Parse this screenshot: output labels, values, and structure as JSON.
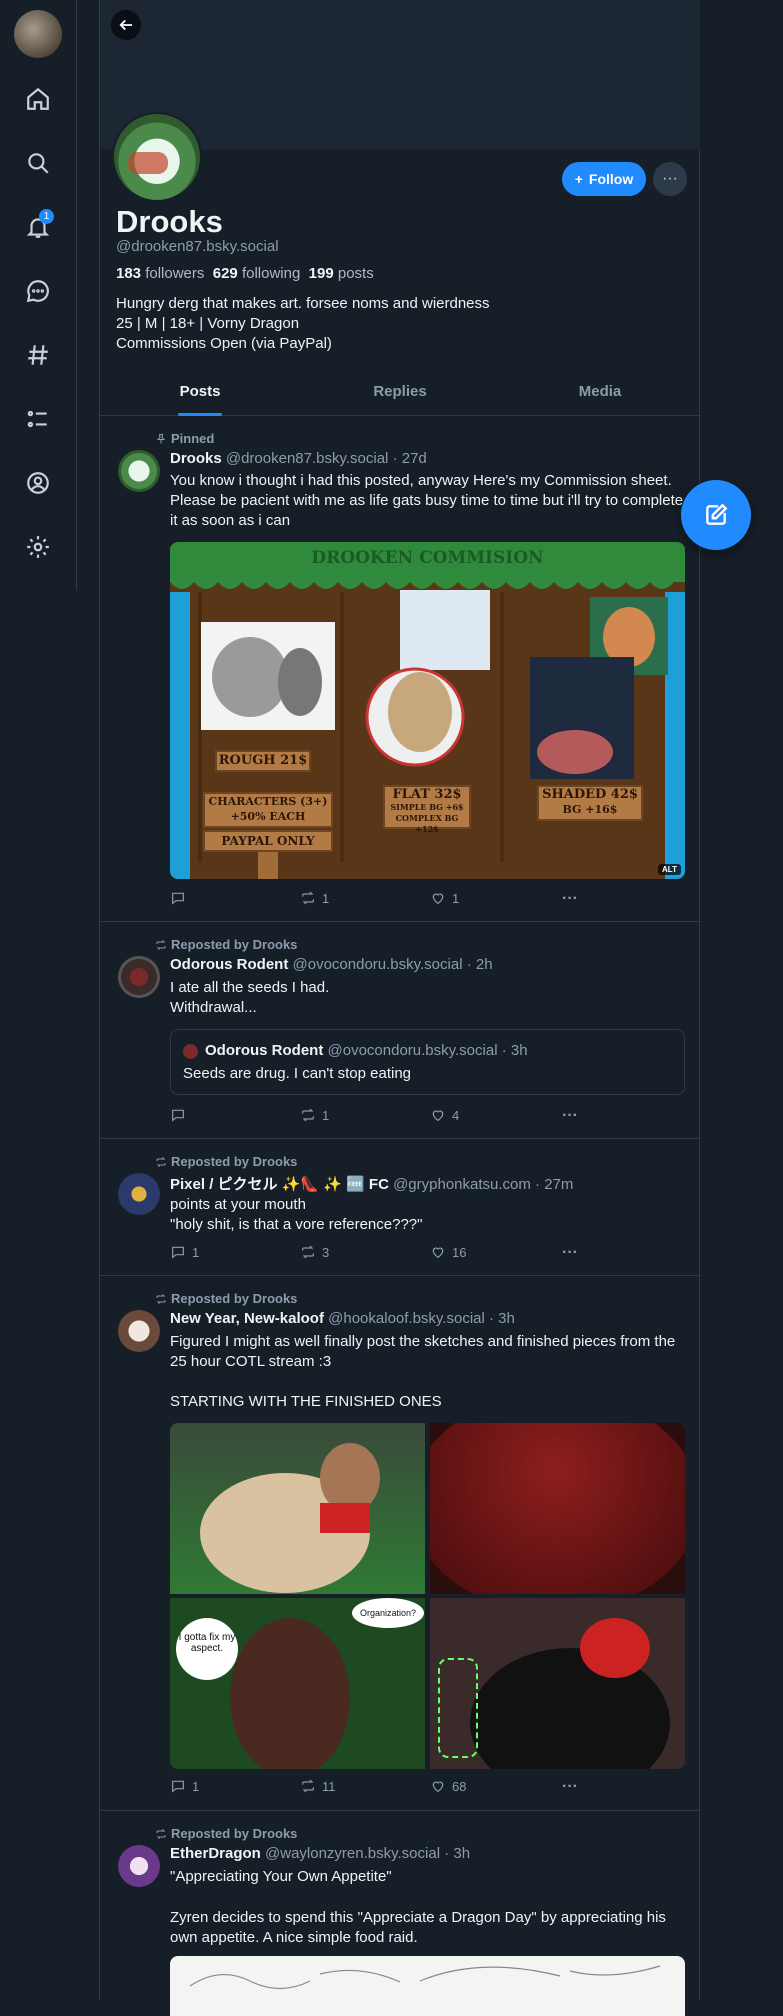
{
  "sidebar": {
    "items": [
      {
        "name": "home",
        "icon": "home-icon"
      },
      {
        "name": "search",
        "icon": "search-icon"
      },
      {
        "name": "notifications",
        "icon": "bell-icon",
        "badge": "1"
      },
      {
        "name": "chat",
        "icon": "chat-icon"
      },
      {
        "name": "feeds",
        "icon": "hash-icon"
      },
      {
        "name": "lists",
        "icon": "list-icon"
      },
      {
        "name": "profile",
        "icon": "user-circle-icon"
      },
      {
        "name": "settings",
        "icon": "gear-icon"
      }
    ]
  },
  "profile": {
    "name": "Drooks",
    "handle": "@drooken87.bsky.social",
    "followers_count": "183",
    "followers_label": "followers",
    "following_count": "629",
    "following_label": "following",
    "posts_count": "199",
    "posts_label": "posts",
    "bio_line1": "Hungry derg that makes art. forsee noms and wierdness",
    "bio_line2": "25 | M | 18+ | Vorny Dragon",
    "bio_line3": "Commissions Open (via PayPal)",
    "follow_label": "Follow"
  },
  "tabs": [
    "Posts",
    "Replies",
    "Media"
  ],
  "posts": [
    {
      "context": "Pinned",
      "author": "Drooks",
      "handle": "@drooken87.bsky.social",
      "time": "· 27d",
      "text": "You know i thought i had this posted, anyway Here's my Commission sheet. Please be pacient with me as life gats busy time to time but i'll try to complete it as soon as i can",
      "image_text": {
        "title": "DROOKEN COMMISION",
        "rough": "ROUGH 21$",
        "characters_l1": "CHARACTERS (3+)",
        "characters_l2": "+50% EACH",
        "paypal": "PAYPAL ONLY",
        "flat": "FLAT 32$",
        "flat_l1": "SIMPLE BG +6$",
        "flat_l2": "COMPLEX BG +12$",
        "shaded": "SHADED 42$",
        "shaded_l1": "BG +16$",
        "alt": "ALT"
      },
      "replies": "",
      "reposts": "1",
      "likes": "1"
    },
    {
      "context": "Reposted by Drooks",
      "author": "Odorous Rodent",
      "handle": "@ovocondoru.bsky.social",
      "time": "· 2h",
      "text_l1": "I ate all the seeds I had.",
      "text_l2": "Withdrawal...",
      "quote_author": "Odorous Rodent",
      "quote_handle": "@ovocondoru.bsky.social",
      "quote_time": "· 3h",
      "quote_text": "Seeds are drug. I can't stop eating",
      "replies": "",
      "reposts": "1",
      "likes": "4"
    },
    {
      "context": "Reposted by Drooks",
      "author": "Pixel / ピクセル ✨👠 ✨ 🆓 FC",
      "handle": "@gryphonkatsu.com",
      "time": "· 27m",
      "text_l1": "points at your mouth",
      "text_l2": "\"holy shit, is that a vore reference???\"",
      "replies": "1",
      "reposts": "3",
      "likes": "16"
    },
    {
      "context": "Reposted by Drooks",
      "author": "New Year, New-kaloof",
      "handle": "@hookaloof.bsky.social",
      "time": "· 3h",
      "text": "Figured I might as well finally post the sketches and finished pieces from the 25 hour COTL stream :3",
      "text2": "STARTING WITH THE FINISHED ONES",
      "bubble1": "I gotta fix my aspect.",
      "bubble2": "Organization?",
      "replies": "1",
      "reposts": "11",
      "likes": "68"
    },
    {
      "context": "Reposted by Drooks",
      "author": "EtherDragon",
      "handle": "@waylonzyren.bsky.social",
      "time": "· 3h",
      "text_l1": "\"Appreciating Your Own Appetite\"",
      "text2": "Zyren decides to spend this \"Appreciate a Dragon Day\" by appreciating his own appetite. A nice simple food raid."
    }
  ],
  "colors": {
    "background": "#161e27",
    "accent": "#208bfe",
    "muted": "#8c9cae",
    "border": "#2c3a4a"
  }
}
